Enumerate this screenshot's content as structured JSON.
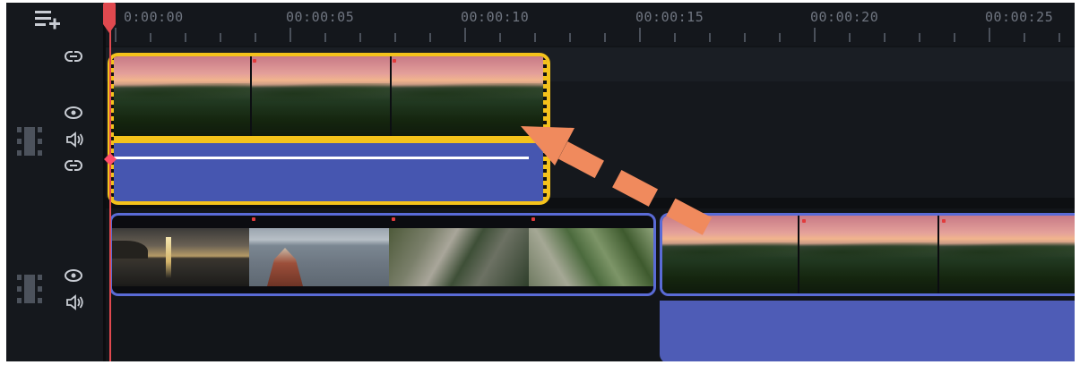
{
  "toolbar": {
    "add_track_icon": "playlist-add-icon"
  },
  "ruler": {
    "labels": [
      "0:00:00",
      "00:00:05",
      "00:00:10",
      "00:00:15",
      "00:00:20",
      "00:00:25"
    ]
  },
  "playhead": {
    "time_label": "0:00:00",
    "color": "#e0494f"
  },
  "overlay_track": {
    "icons": [
      "link-icon",
      "eye-icon",
      "speaker-icon",
      "link-icon",
      "film-strip-icon"
    ],
    "clip": {
      "selected": true,
      "border_color": "#f4c21b",
      "audio_color": "#4656b0",
      "scene": "sunset-over-forest"
    }
  },
  "main_track": {
    "icons": [
      "film-strip-icon",
      "eye-icon",
      "speaker-icon"
    ],
    "clips": [
      {
        "scenes": [
          "sea-sunset",
          "lighthouse-pier",
          "rocky-stream",
          "waterfall-rocks"
        ],
        "border_color": "#5a6bd6"
      },
      {
        "scenes": [
          "sunset-over-forest",
          "sunset-over-forest",
          "sunset-over-forest"
        ],
        "audio_color": "#4e5cb6"
      }
    ]
  },
  "annotation": {
    "arrow_color": "#f08a5d",
    "style": "dashed"
  },
  "colors": {
    "background": "#111418",
    "accent": "#f4c21b",
    "clip_blue": "#5a6bd6"
  }
}
